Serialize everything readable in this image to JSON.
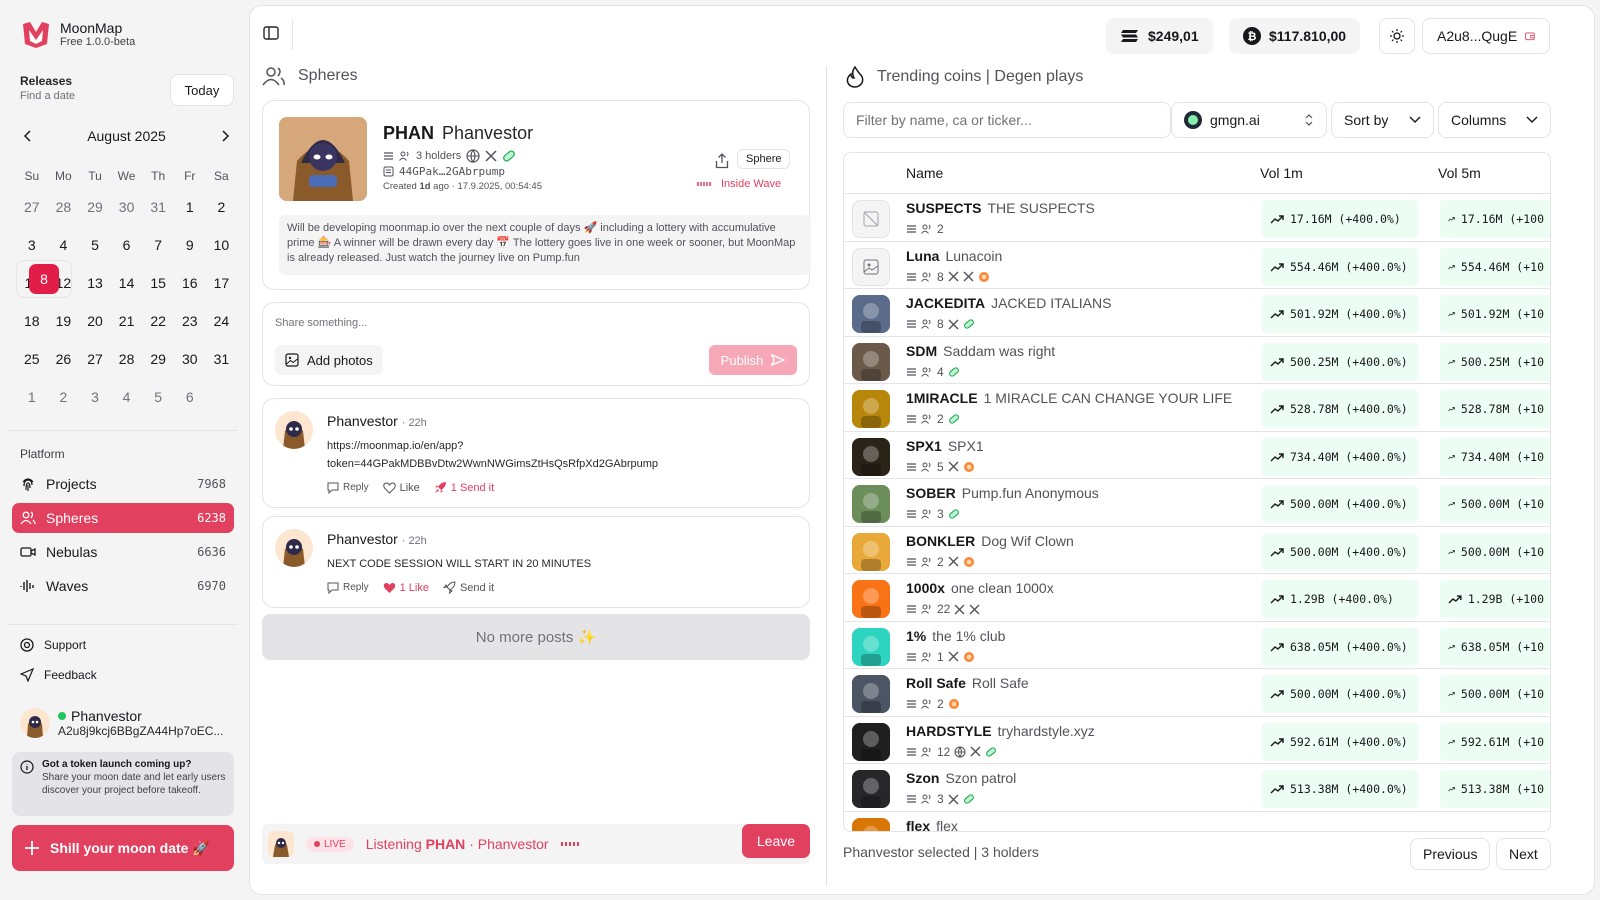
{
  "app": {
    "name": "MoonMap",
    "version": "Free 1.0.0-beta"
  },
  "releases": {
    "title": "Releases",
    "subtitle": "Find a date",
    "today": "Today"
  },
  "calendar": {
    "month": "August 2025",
    "dow": [
      "Su",
      "Mo",
      "Tu",
      "We",
      "Th",
      "Fr",
      "Sa"
    ],
    "days": [
      {
        "d": "27",
        "m": true
      },
      {
        "d": "28",
        "m": true
      },
      {
        "d": "29",
        "m": true
      },
      {
        "d": "30",
        "m": true
      },
      {
        "d": "31",
        "m": true
      },
      {
        "d": "1"
      },
      {
        "d": "2"
      },
      {
        "d": "3"
      },
      {
        "d": "4"
      },
      {
        "d": "5"
      },
      {
        "d": "6"
      },
      {
        "d": "7"
      },
      {
        "d": "8",
        "sel": true
      },
      {
        "d": "9"
      },
      {
        "d": "10"
      },
      {
        "d": "11"
      },
      {
        "d": "12"
      },
      {
        "d": "13"
      },
      {
        "d": "14"
      },
      {
        "d": "15"
      },
      {
        "d": "16"
      },
      {
        "d": "17"
      },
      {
        "d": "18"
      },
      {
        "d": "19"
      },
      {
        "d": "20"
      },
      {
        "d": "21"
      },
      {
        "d": "22"
      },
      {
        "d": "23"
      },
      {
        "d": "24"
      },
      {
        "d": "25"
      },
      {
        "d": "26"
      },
      {
        "d": "27"
      },
      {
        "d": "28"
      },
      {
        "d": "29"
      },
      {
        "d": "30"
      },
      {
        "d": "31"
      },
      {
        "d": "1",
        "m": true
      },
      {
        "d": "2",
        "m": true
      },
      {
        "d": "3",
        "m": true
      },
      {
        "d": "4",
        "m": true
      },
      {
        "d": "5",
        "m": true
      },
      {
        "d": "6",
        "m": true
      }
    ]
  },
  "platform": {
    "label": "Platform",
    "items": [
      {
        "label": "Projects",
        "count": "7968",
        "icon": "fingerprint-icon"
      },
      {
        "label": "Spheres",
        "count": "6238",
        "icon": "users-icon",
        "active": true
      },
      {
        "label": "Nebulas",
        "count": "6636",
        "icon": "video-icon"
      },
      {
        "label": "Waves",
        "count": "6970",
        "icon": "audio-wave-icon"
      }
    ]
  },
  "support": "Support",
  "feedback": "Feedback",
  "user": {
    "name": "Phanvestor",
    "address": "A2u8j9kcj6BBgZA44Hp7oEC..."
  },
  "tip": {
    "title": "Got a token launch coming up?",
    "text": "Share your moon date and let early users discover your project before takeoff."
  },
  "shill": "Shill your moon date 🚀",
  "topbar": {
    "balance_sol": "$249,01",
    "balance_btc": "$117.810,00",
    "wallet": "A2u8...QugE"
  },
  "spheres": {
    "title": "Spheres",
    "project": {
      "ticker": "PHAN",
      "name": "Phanvestor",
      "holders": "3 holders",
      "ca": "44GPak…2GAbrpump",
      "created_prefix": "Created ",
      "created_ago": "1d",
      "created_suffix": " ago · 17.9.2025, 00:54:45",
      "sphere_btn": "Sphere",
      "inside_wave": "Inside Wave",
      "description": "Will be developing moonmap.io over the next couple of days 🚀 including a lottery with accumulative prime 🎰 A winner will be drawn every day 📅 The lottery goes live in one week or sooner, but MoonMap is already released. Just watch the journey live on Pump.fun"
    },
    "composer": {
      "placeholder": "Share something...",
      "add_photos": "Add photos",
      "publish": "Publish"
    },
    "posts": [
      {
        "author": "Phanvestor",
        "time": "· 22h",
        "body_line1": "https://moonmap.io/en/app?",
        "body_line2": "token=44GPakMDBBvDtw2WwnNWGimsZtHsQsRfpXd2GAbrpump",
        "reply": "Reply",
        "like": "Like",
        "send": "1 Send it"
      },
      {
        "author": "Phanvestor",
        "time": "· 22h",
        "body_line1": "NEXT CODE SESSION WILL START IN 20 MINUTES",
        "reply": "Reply",
        "like": "1 Like",
        "send": "Send it"
      }
    ],
    "no_more": "No more posts ✨",
    "live": {
      "badge": "LIVE",
      "listening": "Listening",
      "ticker": "PHAN",
      "name": "· Phanvestor",
      "leave": "Leave"
    }
  },
  "trending": {
    "title": "Trending coins | Degen plays",
    "filter_placeholder": "Filter by name, ca or ticker...",
    "source": "gmgn.ai",
    "sort": "Sort by",
    "columns": "Columns",
    "headers": {
      "name": "Name",
      "vol1": "Vol 1m",
      "vol5": "Vol 5m"
    },
    "rows": [
      {
        "ticker": "SUSPECTS",
        "name": "THE SUSPECTS",
        "holders": "2",
        "x": 0,
        "tg": false,
        "pump": false,
        "vol1": "17.16M (+400.0%)",
        "vol5": "17.16M (+100",
        "img": "none",
        "color": "#f4f4f5"
      },
      {
        "ticker": "Luna",
        "name": "Lunacoin",
        "holders": "8",
        "x": 2,
        "tg": false,
        "pump": true,
        "vol1": "554.46M (+400.0%)",
        "vol5": "554.46M (+10",
        "img": "placeholder",
        "color": "#f4f4f5"
      },
      {
        "ticker": "JACKEDITA",
        "name": "JACKED ITALIANS",
        "holders": "8",
        "x": 1,
        "tg": true,
        "pump": false,
        "vol1": "501.92M (+400.0%)",
        "vol5": "501.92M (+10",
        "img": "photo",
        "color": "#5b6b8a"
      },
      {
        "ticker": "SDM",
        "name": "Saddam was right",
        "holders": "4",
        "x": 0,
        "tg": true,
        "pump": false,
        "vol1": "500.25M (+400.0%)",
        "vol5": "500.25M (+10",
        "img": "photo",
        "color": "#6b5a4a"
      },
      {
        "ticker": "1MIRACLE",
        "name": "1 MIRACLE CAN CHANGE YOUR LIFE",
        "holders": "2",
        "x": 0,
        "tg": true,
        "pump": false,
        "vol1": "528.78M (+400.0%)",
        "vol5": "528.78M (+10",
        "img": "photo",
        "color": "#b8860b"
      },
      {
        "ticker": "SPX1",
        "name": "SPX1",
        "holders": "5",
        "x": 1,
        "tg": false,
        "pump": true,
        "vol1": "734.40M (+400.0%)",
        "vol5": "734.40M (+10",
        "img": "photo",
        "color": "#2a2418"
      },
      {
        "ticker": "SOBER",
        "name": "Pump.fun Anonymous",
        "holders": "3",
        "x": 0,
        "tg": true,
        "pump": false,
        "vol1": "500.00M (+400.0%)",
        "vol5": "500.00M (+10",
        "img": "photo",
        "color": "#6b8e5a"
      },
      {
        "ticker": "BONKLER",
        "name": "Dog Wif Clown",
        "holders": "2",
        "x": 1,
        "tg": false,
        "pump": true,
        "vol1": "500.00M (+400.0%)",
        "vol5": "500.00M (+10",
        "img": "photo",
        "color": "#e8a93a"
      },
      {
        "ticker": "1000x",
        "name": "one clean 1000x",
        "holders": "22",
        "x": 2,
        "tg": false,
        "pump": false,
        "vol1": "1.29B (+400.0%)",
        "vol5": "1.29B (+100",
        "img": "photo",
        "color": "#f97316"
      },
      {
        "ticker": "1%",
        "name": "the 1% club",
        "holders": "1",
        "x": 1,
        "tg": false,
        "pump": true,
        "vol1": "638.05M (+400.0%)",
        "vol5": "638.05M (+10",
        "img": "photo",
        "color": "#2dd4bf"
      },
      {
        "ticker": "Roll Safe",
        "name": "Roll Safe",
        "holders": "2",
        "x": 0,
        "tg": false,
        "pump": true,
        "vol1": "500.00M (+400.0%)",
        "vol5": "500.00M (+10",
        "img": "photo",
        "color": "#4b5563"
      },
      {
        "ticker": "HARDSTYLE",
        "name": "tryhardstyle.xyz",
        "holders": "12",
        "x": 1,
        "tg": true,
        "globe": true,
        "pump": false,
        "vol1": "592.61M (+400.0%)",
        "vol5": "592.61M (+10",
        "img": "photo",
        "color": "#1f1f1f"
      },
      {
        "ticker": "Szon",
        "name": "Szon patrol",
        "holders": "3",
        "x": 1,
        "tg": true,
        "pump": false,
        "vol1": "513.38M (+400.0%)",
        "vol5": "513.38M (+10",
        "img": "photo",
        "color": "#27272a"
      },
      {
        "ticker": "flex",
        "name": "flex",
        "holders": "",
        "x": 0,
        "tg": false,
        "pump": false,
        "vol1": "",
        "vol5": "",
        "img": "photo",
        "color": "#d97706"
      }
    ],
    "footer": "Phanvestor selected | 3 holders",
    "previous": "Previous",
    "next": "Next"
  }
}
